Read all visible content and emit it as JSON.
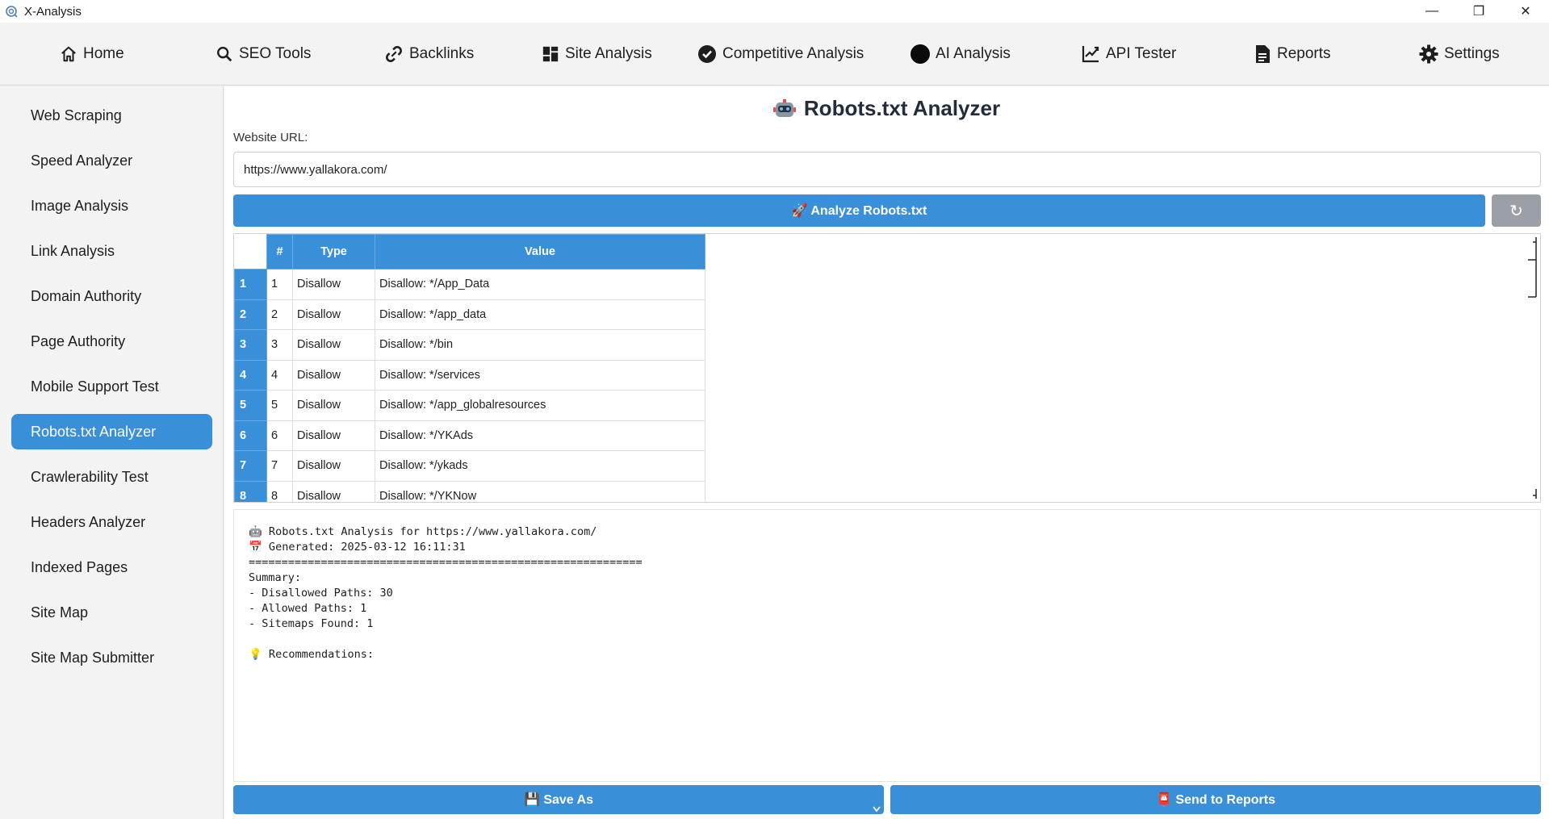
{
  "window": {
    "title": "X-Analysis",
    "minimize": "—",
    "restore": "❐",
    "close": "✕"
  },
  "nav": [
    {
      "label": "Home",
      "icon": "home-icon"
    },
    {
      "label": "SEO Tools",
      "icon": "search-icon"
    },
    {
      "label": "Backlinks",
      "icon": "link-icon"
    },
    {
      "label": "Site Analysis",
      "icon": "grid-icon"
    },
    {
      "label": "Competitive Analysis",
      "icon": "check-circle-icon"
    },
    {
      "label": "AI Analysis",
      "icon": "circle-icon"
    },
    {
      "label": "API Tester",
      "icon": "chart-icon"
    },
    {
      "label": "Reports",
      "icon": "document-icon"
    },
    {
      "label": "Settings",
      "icon": "gear-icon"
    }
  ],
  "sidebar": {
    "items": [
      {
        "label": "Web Scraping"
      },
      {
        "label": "Speed Analyzer"
      },
      {
        "label": "Image Analysis"
      },
      {
        "label": "Link Analysis"
      },
      {
        "label": "Domain Authority"
      },
      {
        "label": "Page Authority"
      },
      {
        "label": "Mobile Support Test"
      },
      {
        "label": "Robots.txt Analyzer",
        "active": true
      },
      {
        "label": "Crawlerability Test"
      },
      {
        "label": "Headers Analyzer"
      },
      {
        "label": "Indexed Pages"
      },
      {
        "label": "Site Map"
      },
      {
        "label": "Site Map Submitter"
      }
    ]
  },
  "main": {
    "title": "Robots.txt Analyzer",
    "url_label": "Website URL:",
    "url_value": "https://www.yallakora.com/",
    "analyze_label": "🚀 Analyze Robots.txt",
    "refresh_symbol": "↻"
  },
  "table": {
    "columns": [
      "#",
      "Type",
      "Value"
    ],
    "rows": [
      {
        "row": "1",
        "num": "1",
        "type": "Disallow",
        "value": "Disallow: */App_Data"
      },
      {
        "row": "2",
        "num": "2",
        "type": "Disallow",
        "value": "Disallow: */app_data"
      },
      {
        "row": "3",
        "num": "3",
        "type": "Disallow",
        "value": "Disallow: */bin"
      },
      {
        "row": "4",
        "num": "4",
        "type": "Disallow",
        "value": "Disallow: */services"
      },
      {
        "row": "5",
        "num": "5",
        "type": "Disallow",
        "value": "Disallow: */app_globalresources"
      },
      {
        "row": "6",
        "num": "6",
        "type": "Disallow",
        "value": "Disallow: */YKAds"
      },
      {
        "row": "7",
        "num": "7",
        "type": "Disallow",
        "value": "Disallow: */ykads"
      },
      {
        "row": "8",
        "num": "8",
        "type": "Disallow",
        "value": "Disallow: */YKNow"
      }
    ]
  },
  "report": {
    "lines": [
      "🤖 Robots.txt Analysis for https://www.yallakora.com/",
      "📅 Generated: 2025-03-12 16:11:31",
      "============================================================",
      "Summary:",
      "- Disallowed Paths: 30",
      "- Allowed Paths: 1",
      "- Sitemaps Found: 1",
      "",
      "💡 Recommendations:"
    ]
  },
  "actions": {
    "save_as": "💾 Save As",
    "send_to_reports": "📮 Send to Reports"
  },
  "colors": {
    "accent": "#3a8fd9",
    "refresh": "#9aa0a6"
  }
}
